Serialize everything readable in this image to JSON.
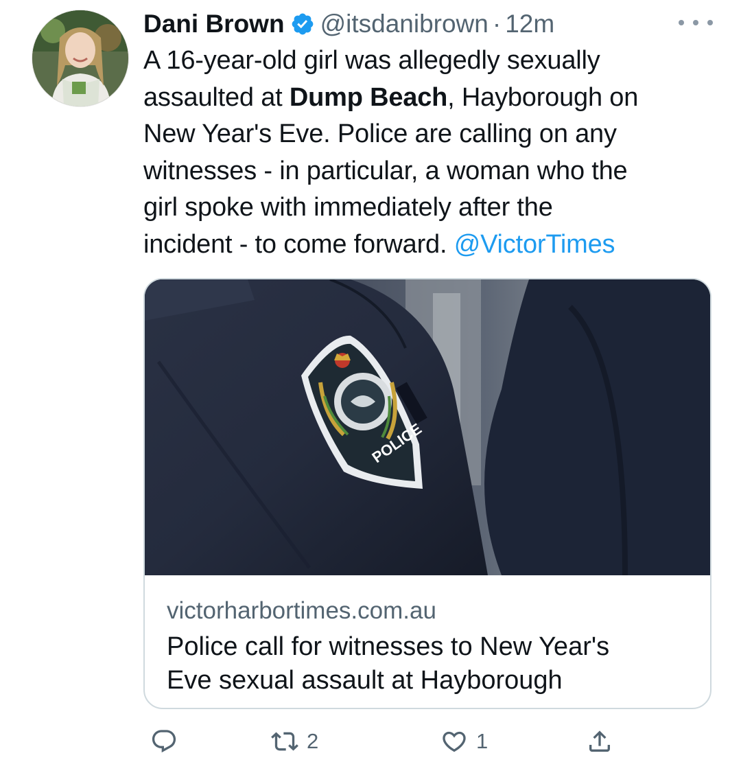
{
  "tweet": {
    "author_name": "Dani Brown",
    "handle": "@itsdanibrown",
    "separator": "·",
    "time": "12m",
    "text_lines": [
      [
        "A 16-year-old girl was allegedly sexually"
      ],
      [
        "assaulted at ",
        "Dump Beach",
        ", Hayborough on"
      ],
      [
        "New Year's Eve. Police are calling on any"
      ],
      [
        "witnesses - in particular, a woman who the"
      ],
      [
        "girl spoke with immediately after the"
      ],
      [
        "incident - to come forward. ",
        "@VictorTimes"
      ]
    ],
    "bold_phrase": "Dump Beach",
    "mention": "@VictorTimes"
  },
  "card": {
    "patch_text": "POLICE",
    "domain": "victorharbortimes.com.au",
    "title_line1": "Police call for witnesses to New Year's",
    "title_line2": "Eve sexual assault at Hayborough"
  },
  "actions": {
    "reply": {
      "icon": "reply-icon",
      "count": ""
    },
    "retweet": {
      "icon": "retweet-icon",
      "count": "2"
    },
    "like": {
      "icon": "heart-icon",
      "count": "1"
    },
    "share": {
      "icon": "share-icon",
      "count": ""
    }
  },
  "colors": {
    "link": "#1d9bf0",
    "secondary_text": "#536471",
    "verified": "#1d9bf0"
  }
}
